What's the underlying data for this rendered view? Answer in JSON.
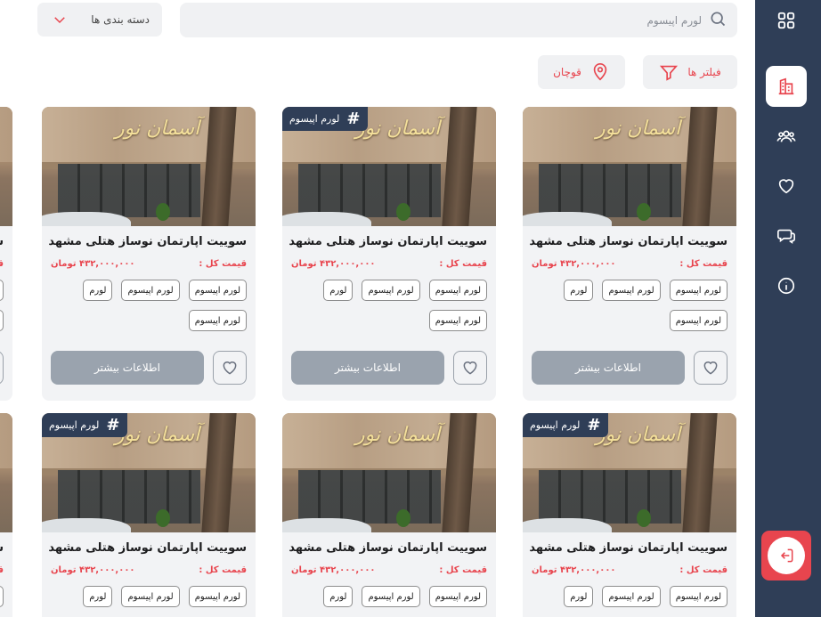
{
  "header": {
    "search_placeholder": "لورم اپیسوم",
    "category_label": "دسته بندی ها",
    "filters_label": "فیلتر ها",
    "location_label": "قوچان"
  },
  "sidebar": {
    "items": [
      "apps-icon",
      "building-icon",
      "users-icon",
      "heart-icon",
      "chat-icon",
      "info-icon"
    ],
    "active": "building-icon",
    "logout": "logout-icon"
  },
  "colors": {
    "accent": "#e8454e",
    "navy": "#2f3e57",
    "card_bg": "#f2f3f5",
    "button_gray": "#9aa3ae"
  },
  "cards": [
    {
      "title": "سوییت اپارتمان نوساز هتلی مشهد",
      "price_label": "قیمت کل :",
      "price": "۴۳۲,۰۰۰,۰۰۰ تومان",
      "chips": [
        "لورم اپیسوم",
        "لورم اپیسوم",
        "لورم",
        "لورم اپیسوم"
      ],
      "more": "اطلاعات بیشتر",
      "sign": "آسمان نور"
    },
    {
      "title": "سوییت اپارتمان نوساز هتلی مشهد",
      "price_label": "قیمت کل :",
      "price": "۴۳۲,۰۰۰,۰۰۰ تومان",
      "chips": [
        "لورم اپیسوم",
        "لورم اپیسوم",
        "لورم",
        "لورم اپیسوم"
      ],
      "more": "اطلاعات بیشتر",
      "tag": "لورم اپیسوم",
      "sign": "آسمان نور"
    },
    {
      "title": "سوییت اپارتمان نوساز هتلی مشهد",
      "price_label": "قیمت کل :",
      "price": "۴۳۲,۰۰۰,۰۰۰ تومان",
      "chips": [
        "لورم اپیسوم",
        "لورم اپیسوم",
        "لورم",
        "لورم اپیسوم"
      ],
      "more": "اطلاعات بیشتر",
      "sign": "آسمان نور"
    },
    {
      "title": "سوییت اپارتمان نوساز هتلی مشهد",
      "price_label": "قیمت کل :",
      "price": "۴۳۲,۰۰۰,۰۰۰ تومان",
      "chips": [
        "لورم اپیسوم",
        "لورم اپیسوم",
        "لورم"
      ],
      "tag": "لورم اپیسوم",
      "sign": "آسمان نور"
    },
    {
      "title": "سوییت اپارتمان نوساز هتلی مشهد",
      "price_label": "قیمت کل :",
      "price": "۴۳۲,۰۰۰,۰۰۰ تومان",
      "chips": [
        "لورم اپیسوم",
        "لورم اپیسوم",
        "لورم"
      ],
      "sign": "آسمان نور"
    },
    {
      "title": "سوییت اپارتمان نوساز هتلی مشهد",
      "price_label": "قیمت کل :",
      "price": "۴۳۲,۰۰۰,۰۰۰ تومان",
      "chips": [
        "لورم اپیسوم",
        "لورم اپیسوم",
        "لورم"
      ],
      "tag": "لورم اپیسوم",
      "sign": "آسمان نور"
    }
  ],
  "partial_left": {
    "title": "س",
    "price": "ق"
  }
}
